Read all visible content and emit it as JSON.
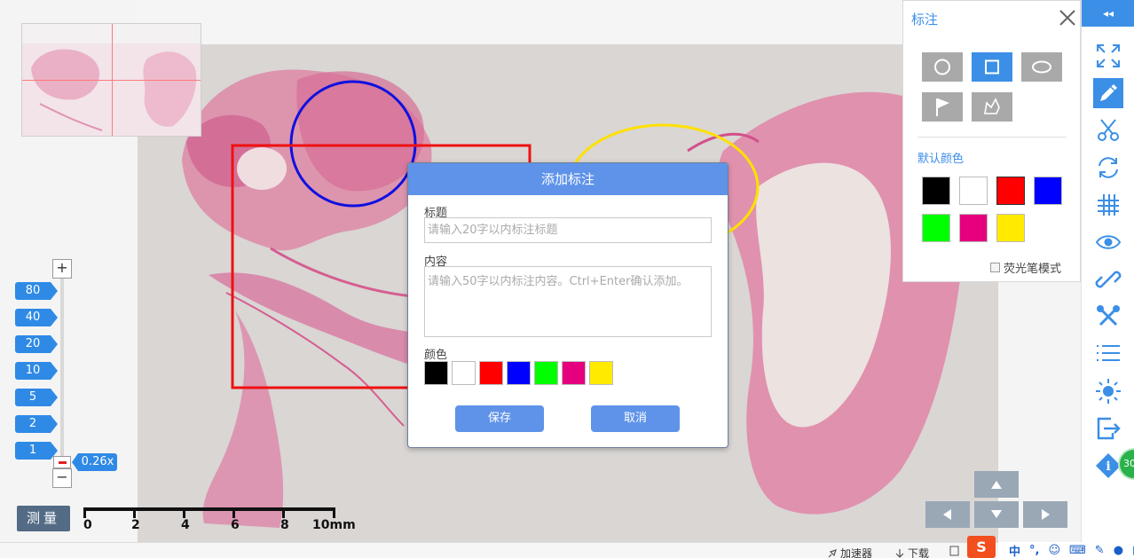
{
  "thumbnail": {
    "label": "slide-overview"
  },
  "zoom": {
    "plus": "+",
    "minus": "−",
    "levels": [
      "80",
      "40",
      "20",
      "10",
      "5",
      "2",
      "1"
    ],
    "current": "0.26x"
  },
  "measure": {
    "label": "测量"
  },
  "scale": {
    "ticks": [
      "0",
      "2",
      "4",
      "6",
      "8",
      "10mm"
    ]
  },
  "dialog": {
    "title": "添加标注",
    "title_label": "标题",
    "title_placeholder": "请输入20字以内标注标题",
    "content_label": "内容",
    "content_placeholder": "请输入50字以内标注内容。Ctrl+Enter确认添加。",
    "color_label": "颜色",
    "colors": [
      "#000000",
      "#ffffff",
      "#ff0000",
      "#0000ff",
      "#00ff00",
      "#e6007e",
      "#ffea00"
    ],
    "save": "保存",
    "cancel": "取消"
  },
  "annotation_panel": {
    "title": "标注",
    "shapes": [
      "circle",
      "rectangle",
      "ellipse",
      "flag",
      "polygon"
    ],
    "active_shape": "rectangle",
    "default_color_label": "默认颜色",
    "colors": [
      "#000000",
      "#ffffff",
      "#ff0000",
      "#0000ff",
      "#00ff00",
      "#e6007e",
      "#ffea00"
    ],
    "selected_color": "#ff0000",
    "highlighter_label": "荧光笔模式"
  },
  "toolbar": {
    "collapse": "◂◂",
    "items": [
      "fullscreen-icon",
      "pencil-icon",
      "scissors-icon",
      "rotate-icon",
      "grid-icon",
      "eye-icon",
      "link-icon",
      "tools-icon",
      "list-icon",
      "brightness-icon",
      "export-icon",
      "info-icon"
    ],
    "active": "pencil-icon",
    "badge": "30"
  },
  "statusbar": {
    "accelerator": "加速器",
    "download": "下载"
  },
  "ime": {
    "logo": "S",
    "mode": "中"
  },
  "annotations_on_slide": [
    {
      "shape": "circle",
      "color": "#0000ff"
    },
    {
      "shape": "rectangle",
      "color": "#ff0000"
    },
    {
      "shape": "ellipse",
      "color": "#ffe000"
    }
  ]
}
